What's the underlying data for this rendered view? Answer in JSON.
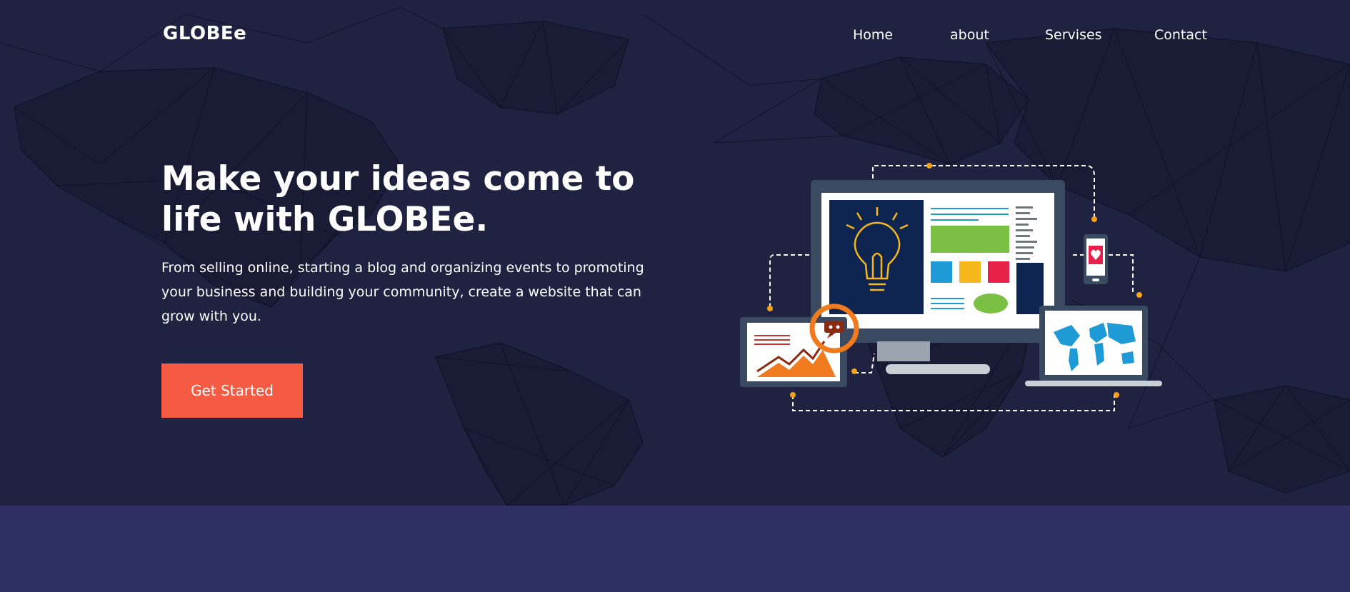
{
  "brand": {
    "logo_text": "GLOBEe"
  },
  "nav": {
    "items": [
      {
        "label": "Home"
      },
      {
        "label": "about"
      },
      {
        "label": "Servises"
      },
      {
        "label": "Contact"
      }
    ]
  },
  "hero": {
    "headline": "Make your ideas come to life with GLOBEe.",
    "subtext": "From selling online, starting a blog and organizing events to promoting your business and building your community, create a website that can grow with you.",
    "cta_label": "Get Started"
  },
  "illustration": {
    "icons": [
      "world-map-mesh",
      "monitor-icon",
      "lightbulb-icon",
      "analytics-chart-icon",
      "chat-bubble-icon",
      "smartphone-heart-icon",
      "laptop-world-map-icon"
    ]
  },
  "colors": {
    "hero_background": "#1f2240",
    "lower_section": "#2e2f63",
    "cta": "#f55a42",
    "text": "#ffffff",
    "accent_orange": "#f07a1e",
    "accent_green": "#7ac143",
    "accent_blue": "#1e9ad6",
    "accent_yellow": "#f6b71a",
    "accent_red": "#e8214a"
  }
}
